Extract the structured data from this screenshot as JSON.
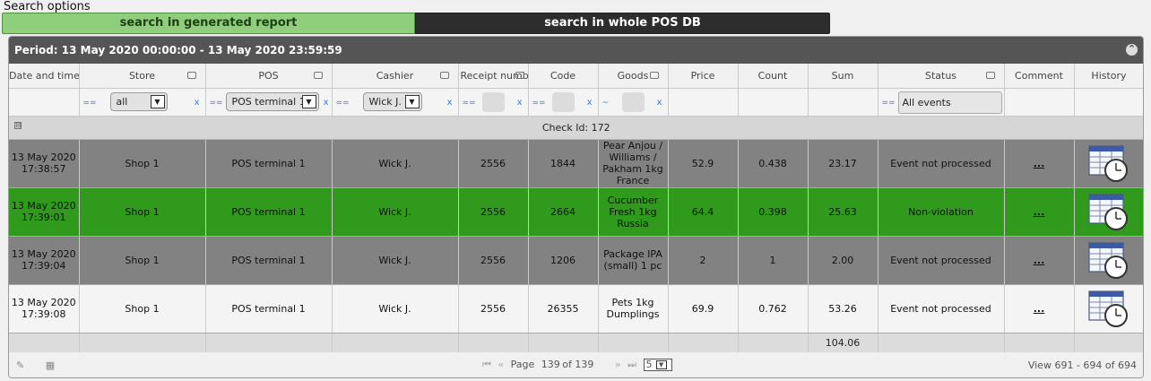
{
  "search_options": {
    "label": "Search options",
    "btn_generated": "search in generated report",
    "btn_whole_db": "search in whole POS DB"
  },
  "panel": {
    "period": "Period: 13 May 2020 00:00:00 - 13 May 2020 23:59:59"
  },
  "columns": [
    "Date and time",
    "Store",
    "POS",
    "Cashier",
    "Receipt number",
    "Code",
    "Goods",
    "Price",
    "Count",
    "Sum",
    "Status",
    "Comment",
    "History"
  ],
  "filters": {
    "op_equal": "==",
    "op_like": "~",
    "clear": "x",
    "store_value": "all",
    "pos_value": "POS terminal 1",
    "cashier_value": "Wick J.",
    "status_value": "All events",
    "arrow": "▼"
  },
  "group": {
    "toggle": "⊟",
    "label": "Check Id: 172"
  },
  "rows": [
    {
      "date": "13 May 2020",
      "time": "17:38:57",
      "store": "Shop 1",
      "pos": "POS terminal 1",
      "cashier": "Wick J.",
      "receipt": "2556",
      "code": "1844",
      "goods": "Pear Anjou / Williams / Pakham 1kg France",
      "price": "52.9",
      "count": "0.438",
      "sum": "23.17",
      "status": "Event not processed",
      "comment": "...",
      "style": "gray"
    },
    {
      "date": "13 May 2020",
      "time": "17:39:01",
      "store": "Shop 1",
      "pos": "POS terminal 1",
      "cashier": "Wick J.",
      "receipt": "2556",
      "code": "2664",
      "goods": "Cucumber Fresh 1kg Russia",
      "price": "64.4",
      "count": "0.398",
      "sum": "25.63",
      "status": "Non-violation",
      "comment": "...",
      "style": "green"
    },
    {
      "date": "13 May 2020",
      "time": "17:39:04",
      "store": "Shop 1",
      "pos": "POS terminal 1",
      "cashier": "Wick J.",
      "receipt": "2556",
      "code": "1206",
      "goods": "Package IPA (small) 1 pc",
      "price": "2",
      "count": "1",
      "sum": "2.00",
      "status": "Event not processed",
      "comment": "...",
      "style": "gray"
    },
    {
      "date": "13 May 2020",
      "time": "17:39:08",
      "store": "Shop 1",
      "pos": "POS terminal 1",
      "cashier": "Wick J.",
      "receipt": "2556",
      "code": "26355",
      "goods": "Pets 1kg Dumplings",
      "price": "69.9",
      "count": "0.762",
      "sum": "53.26",
      "status": "Event not processed",
      "comment": "...",
      "style": "white"
    }
  ],
  "totals": {
    "sum": "104.06"
  },
  "pager": {
    "page_label": "Page",
    "page_value": "139",
    "of_label": "of 139",
    "rows_per_page": "5",
    "view_text": "View 691 - 694 of 694",
    "first": "⏮",
    "prev": "«",
    "next": "»",
    "last": "⏭"
  },
  "colors": {
    "row_gray": "#828282",
    "row_green": "#2f9a1b",
    "header_bar": "#555555"
  }
}
